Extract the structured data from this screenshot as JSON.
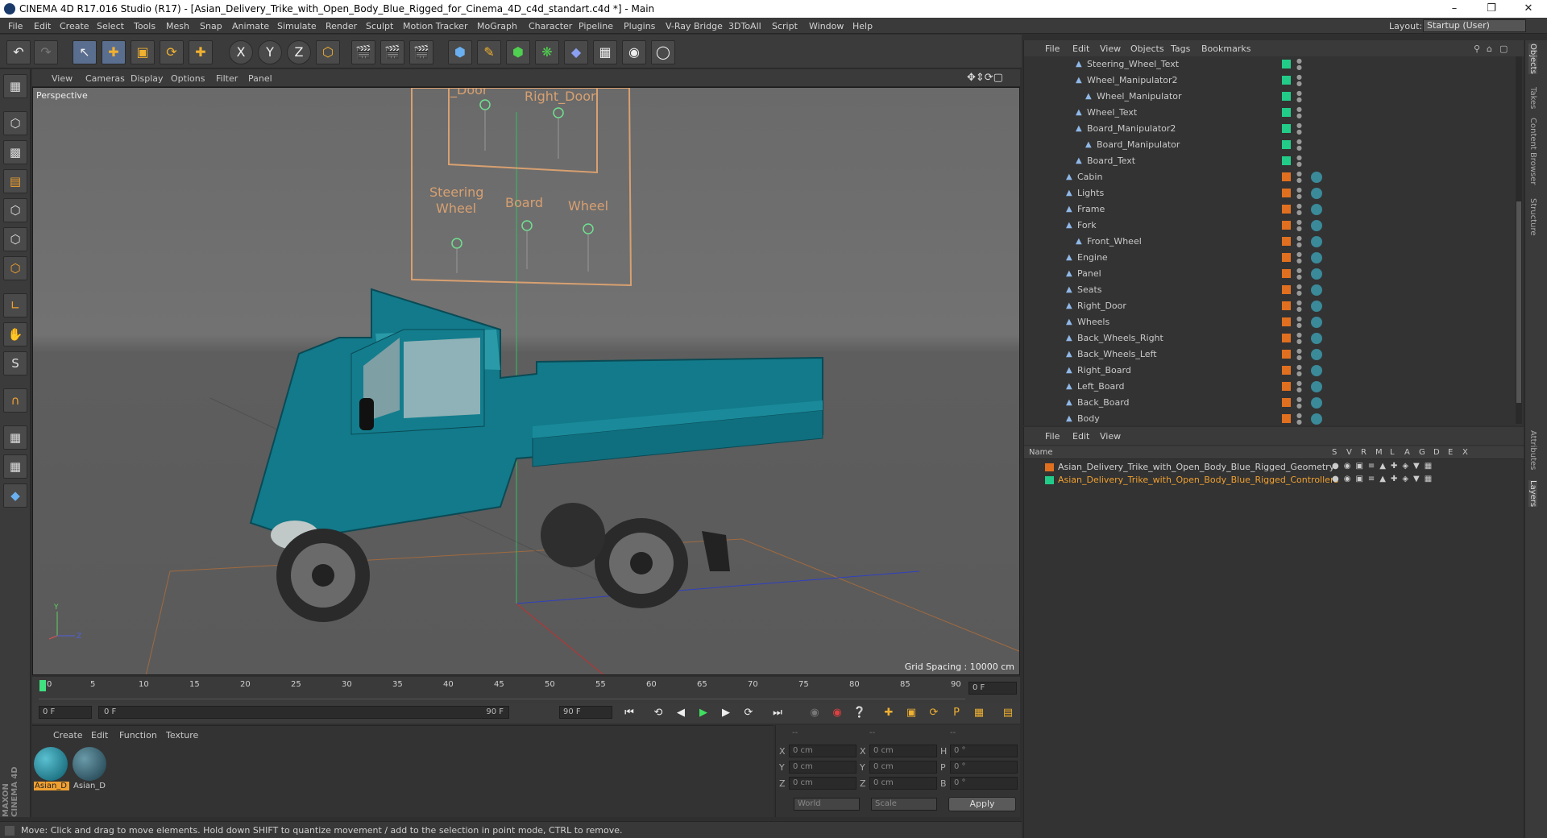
{
  "window": {
    "title": "CINEMA 4D R17.016 Studio (R17) - [Asian_Delivery_Trike_with_Open_Body_Blue_Rigged_for_Cinema_4D_c4d_standart.c4d *] - Main",
    "min": "–",
    "max": "❐",
    "close": "✕"
  },
  "menu": {
    "items": [
      "File",
      "Edit",
      "Create",
      "Select",
      "Tools",
      "Mesh",
      "Snap",
      "Animate",
      "Simulate",
      "Render",
      "Sculpt",
      "Motion Tracker",
      "MoGraph",
      "Character",
      "Pipeline",
      "Plugins",
      "V-Ray Bridge",
      "3DToAll",
      "Script",
      "Window",
      "Help"
    ],
    "layout_label": "Layout:",
    "layout_value": "Startup (User)"
  },
  "toolbar": {
    "undo": "↶",
    "redo": "↷",
    "x": "X",
    "y": "Y",
    "z": "Z"
  },
  "viewport": {
    "menu": [
      "View",
      "Cameras",
      "Display",
      "Options",
      "Filter",
      "Panel"
    ],
    "label": "Perspective",
    "grid_spacing": "Grid Spacing : 10000 cm",
    "ctrl_labels": [
      "Steering",
      "Wheel",
      "Board",
      "Wheel",
      "_Door",
      "Right_Door"
    ]
  },
  "timeline": {
    "ticks": [
      "0",
      "5",
      "10",
      "15",
      "20",
      "25",
      "30",
      "35",
      "40",
      "45",
      "50",
      "55",
      "60",
      "65",
      "70",
      "75",
      "80",
      "85",
      "90"
    ],
    "frame_right": "0 F"
  },
  "transport": {
    "start": "0 F",
    "range_start": "0 F",
    "range_end": "90 F",
    "end": "90 F"
  },
  "materials": {
    "menu": [
      "Create",
      "Edit",
      "Function",
      "Texture"
    ],
    "items": [
      "Asian_D",
      "Asian_D"
    ]
  },
  "coords": {
    "header": [
      "--",
      "--",
      "--"
    ],
    "rows": [
      [
        "X",
        "0 cm",
        "X",
        "0 cm",
        "H",
        "0 °"
      ],
      [
        "Y",
        "0 cm",
        "Y",
        "0 cm",
        "P",
        "0 °"
      ],
      [
        "Z",
        "0 cm",
        "Z",
        "0 cm",
        "B",
        "0 °"
      ]
    ],
    "world": "World",
    "scale": "Scale",
    "apply": "Apply"
  },
  "status": "Move: Click and drag to move elements. Hold down SHIFT to quantize movement / add to the selection in point mode, CTRL to remove.",
  "objects": {
    "menu": [
      "File",
      "Edit",
      "View",
      "Objects",
      "Tags",
      "Bookmarks"
    ],
    "rows": [
      {
        "name": "Steering_Wheel_Text",
        "indent": 2,
        "color": "#22cc88"
      },
      {
        "name": "Wheel_Manipulator2",
        "indent": 2,
        "color": "#22cc88"
      },
      {
        "name": "Wheel_Manipulator",
        "indent": 3,
        "color": "#22cc88"
      },
      {
        "name": "Wheel_Text",
        "indent": 2,
        "color": "#22cc88"
      },
      {
        "name": "Board_Manipulator2",
        "indent": 2,
        "color": "#22cc88"
      },
      {
        "name": "Board_Manipulator",
        "indent": 3,
        "color": "#22cc88"
      },
      {
        "name": "Board_Text",
        "indent": 2,
        "color": "#22cc88"
      },
      {
        "name": "Cabin",
        "indent": 1,
        "color": "#e07020"
      },
      {
        "name": "Lights",
        "indent": 1,
        "color": "#e07020"
      },
      {
        "name": "Frame",
        "indent": 1,
        "color": "#e07020"
      },
      {
        "name": "Fork",
        "indent": 1,
        "color": "#e07020"
      },
      {
        "name": "Front_Wheel",
        "indent": 2,
        "color": "#e07020"
      },
      {
        "name": "Engine",
        "indent": 1,
        "color": "#e07020"
      },
      {
        "name": "Panel",
        "indent": 1,
        "color": "#e07020"
      },
      {
        "name": "Seats",
        "indent": 1,
        "color": "#e07020"
      },
      {
        "name": "Right_Door",
        "indent": 1,
        "color": "#e07020"
      },
      {
        "name": "Wheels",
        "indent": 1,
        "color": "#e07020"
      },
      {
        "name": "Back_Wheels_Right",
        "indent": 1,
        "color": "#e07020"
      },
      {
        "name": "Back_Wheels_Left",
        "indent": 1,
        "color": "#e07020"
      },
      {
        "name": "Right_Board",
        "indent": 1,
        "color": "#e07020"
      },
      {
        "name": "Left_Board",
        "indent": 1,
        "color": "#e07020"
      },
      {
        "name": "Back_Board",
        "indent": 1,
        "color": "#e07020"
      },
      {
        "name": "Body",
        "indent": 1,
        "color": "#e07020"
      }
    ]
  },
  "layers": {
    "menu": [
      "File",
      "Edit",
      "View"
    ],
    "header": [
      "Name",
      "S",
      "V",
      "R",
      "M",
      "L",
      "A",
      "G",
      "D",
      "E",
      "X"
    ],
    "rows": [
      {
        "name": "Asian_Delivery_Trike_with_Open_Body_Blue_Rigged_Geometry",
        "color": "#e07020"
      },
      {
        "name": "Asian_Delivery_Trike_with_Open_Body_Blue_Rigged_Controllers",
        "color": "#22cc88"
      }
    ]
  },
  "right_tabs": [
    "Objects",
    "Takes",
    "Content Browser",
    "Structure",
    "Attributes",
    "Layers"
  ]
}
